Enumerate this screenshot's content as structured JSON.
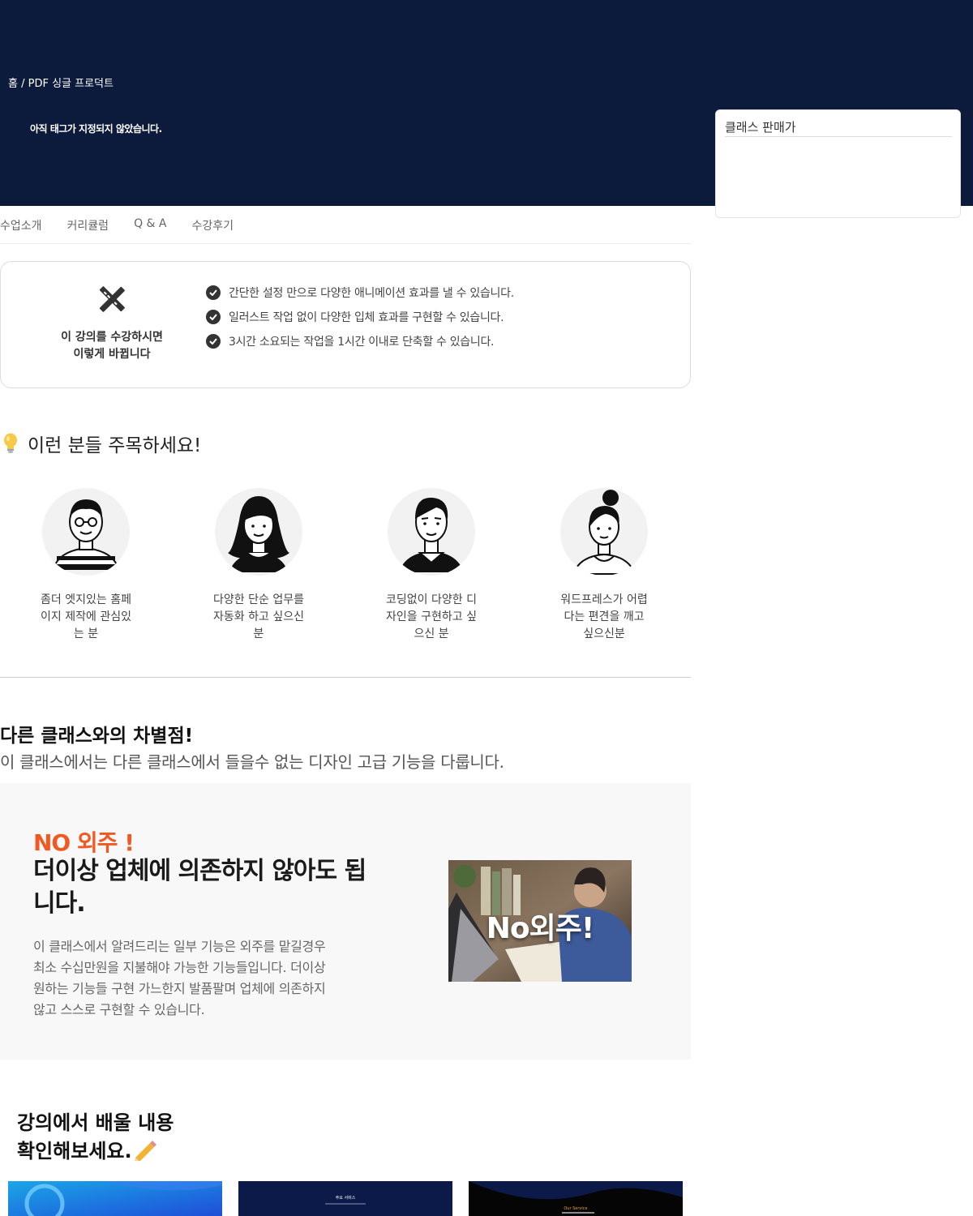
{
  "header": {
    "breadcrumb_home": "홈",
    "breadcrumb_sep": " / ",
    "breadcrumb_current": "PDF 싱글 프로덕트",
    "tag_note": "아직 태그가 지정되지 않았습니다."
  },
  "seller": {
    "title": "클래스 판매가"
  },
  "tabs": [
    {
      "label": "수업소개"
    },
    {
      "label": "커리큘럼"
    },
    {
      "label": "Q & A"
    },
    {
      "label": "수강후기"
    }
  ],
  "benefits": {
    "icon": "pencil-ruler-icon",
    "caption_line1": "이 강의를 수강하시면",
    "caption_line2": "이렇게 바뀝니다",
    "items": [
      "간단한 설정 만으로 다양한 애니메이션 효과를 낼 수 있습니다.",
      "일러스트 작업 없이 다양한 입체 효과를 구현할 수 있습니다.",
      "3시간 소요되는 작업을 1시간 이내로 단축할 수 있습니다."
    ]
  },
  "audience": {
    "heading": "이런 분들 주목하세요!",
    "icon": "lightbulb-icon",
    "personas": [
      {
        "line1": "좀더 엣지있는 홈페",
        "line2": "이지 제작에 관심있",
        "line3": "는 분"
      },
      {
        "line1": "다양한 단순 업무를",
        "line2": "자동화 하고 싶으신",
        "line3": "분"
      },
      {
        "line1": "코딩없이 다양한 디",
        "line2": "자인을 구현하고 싶",
        "line3": "으신 분"
      },
      {
        "line1": "워드프레스가 어렵",
        "line2": "다는 편견을 깨고",
        "line3": "싶으신분"
      }
    ]
  },
  "difference": {
    "title": "다른 클래스와의 차별점!",
    "subtitle": "이 클래스에서는 다른 클래스에서 들을수 없는 디자인 고급 기능을 다룹니다."
  },
  "no_outsourcing": {
    "accent": "NO 외주 !",
    "headline_line1": "더이상 업체에 의존하지 않아도 됩",
    "headline_line2": "니다.",
    "body_line1": "이 클래스에서 알려드리는 일부 기능은 외주를 맡길경우",
    "body_line2": "최소 수십만원을 지불해야 가능한 기능들입니다. 더이상",
    "body_line3": "원하는 기능들 구현 가느한지 발품팔며 업체에 의존하지",
    "body_line4": "않고 스스로 구현할 수 있습니다.",
    "image_text": "No외주!"
  },
  "learn": {
    "title_line1": "강의에서 배울 내용",
    "title_line2": "확인해보세요.",
    "icon": "pencil-icon",
    "thumb2_label": "주요 서비스",
    "thumb3_label": "Our Service"
  },
  "colors": {
    "hero_bg": "#0c1a3c",
    "accent_orange": "#f05a22",
    "panel_bg": "#f8f8f8"
  }
}
